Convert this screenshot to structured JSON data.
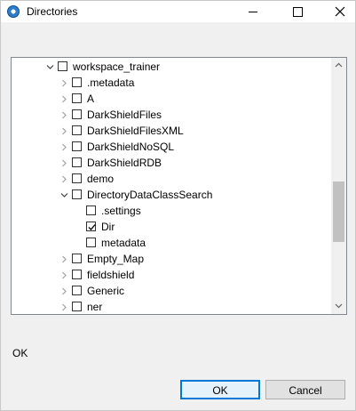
{
  "window": {
    "title": "Directories"
  },
  "tree": {
    "items": [
      {
        "label": "workspace_trainer",
        "expanded": true,
        "checked": false,
        "has_children": true
      },
      {
        "label": ".metadata",
        "expanded": false,
        "checked": false,
        "has_children": true
      },
      {
        "label": "A",
        "expanded": false,
        "checked": false,
        "has_children": true
      },
      {
        "label": "DarkShieldFiles",
        "expanded": false,
        "checked": false,
        "has_children": true
      },
      {
        "label": "DarkShieldFilesXML",
        "expanded": false,
        "checked": false,
        "has_children": true
      },
      {
        "label": "DarkShieldNoSQL",
        "expanded": false,
        "checked": false,
        "has_children": true
      },
      {
        "label": "DarkShieldRDB",
        "expanded": false,
        "checked": false,
        "has_children": true
      },
      {
        "label": "demo",
        "expanded": false,
        "checked": false,
        "has_children": true
      },
      {
        "label": "DirectoryDataClassSearch",
        "expanded": true,
        "checked": false,
        "has_children": true
      },
      {
        "label": ".settings",
        "expanded": false,
        "checked": false,
        "has_children": false
      },
      {
        "label": "Dir",
        "expanded": false,
        "checked": true,
        "has_children": false
      },
      {
        "label": "metadata",
        "expanded": false,
        "checked": false,
        "has_children": false
      },
      {
        "label": "Empty_Map",
        "expanded": false,
        "checked": false,
        "has_children": true
      },
      {
        "label": "fieldshield",
        "expanded": false,
        "checked": false,
        "has_children": true
      },
      {
        "label": "Generic",
        "expanded": false,
        "checked": false,
        "has_children": true
      },
      {
        "label": "ner",
        "expanded": false,
        "checked": false,
        "has_children": true
      }
    ]
  },
  "status": {
    "message": "OK"
  },
  "buttons": {
    "ok_label": "OK",
    "cancel_label": "Cancel"
  }
}
